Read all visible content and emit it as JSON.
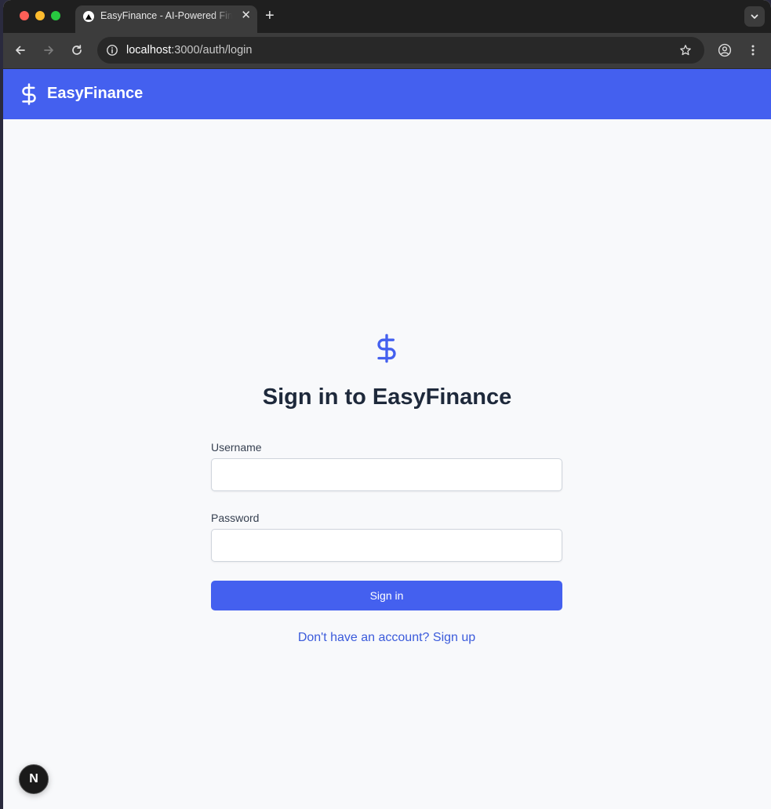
{
  "browser": {
    "tab_title": "EasyFinance - AI-Powered Finance",
    "tab_close": "✕",
    "new_tab": "+",
    "url_host": "localhost",
    "url_path": ":3000/auth/login"
  },
  "header": {
    "app_name": "EasyFinance",
    "brand_color": "#4460ef"
  },
  "login": {
    "heading": "Sign in to EasyFinance",
    "username_label": "Username",
    "username_value": "",
    "password_label": "Password",
    "password_value": "",
    "submit_label": "Sign in",
    "signup_link": "Don't have an account? Sign up"
  },
  "dev_badge": {
    "label": "N"
  }
}
